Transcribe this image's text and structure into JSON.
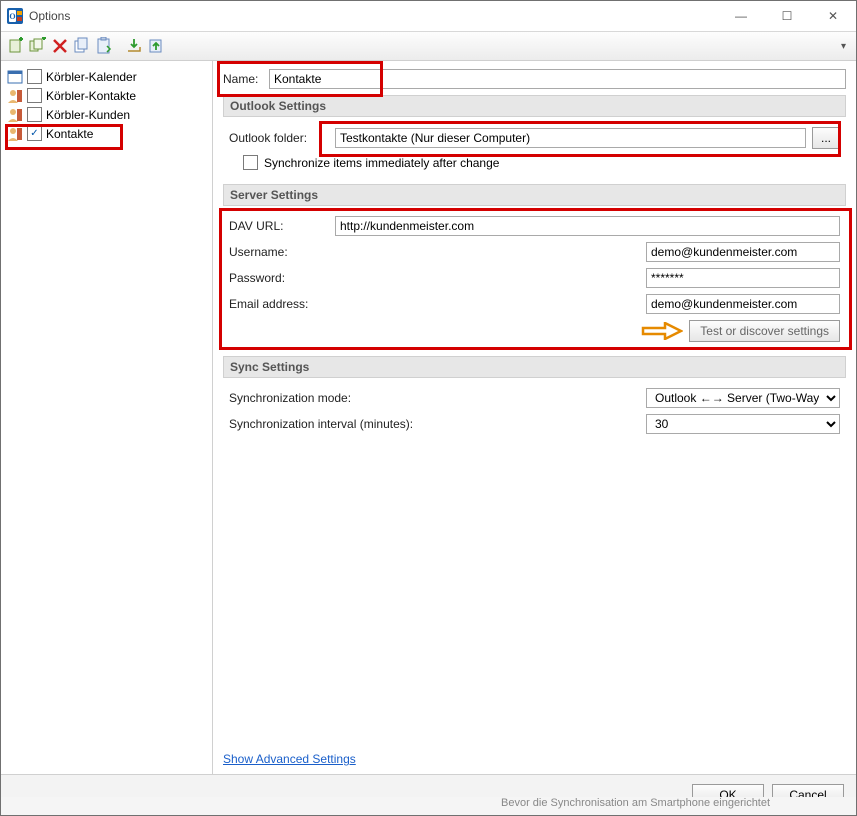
{
  "window": {
    "title": "Options"
  },
  "win": {
    "min": "—",
    "max": "☐",
    "close": "✕"
  },
  "sidebar": {
    "items": [
      {
        "label": "Körbler-Kalender",
        "checked": false,
        "icon": "calendar"
      },
      {
        "label": "Körbler-Kontakte",
        "checked": false,
        "icon": "contacts"
      },
      {
        "label": "Körbler-Kunden",
        "checked": false,
        "icon": "contacts"
      },
      {
        "label": "Kontakte",
        "checked": true,
        "icon": "contacts"
      }
    ]
  },
  "form": {
    "name_label": "Name:",
    "name_value": "Kontakte",
    "section_outlook": "Outlook Settings",
    "outlook_folder_label": "Outlook folder:",
    "outlook_folder_value": "Testkontakte (Nur dieser Computer)",
    "outlook_browse": "...",
    "sync_immediately_label": "Synchronize items immediately after change",
    "section_server": "Server Settings",
    "dav_url_label": "DAV URL:",
    "dav_url_value": "http://kundenmeister.com",
    "username_label": "Username:",
    "username_value": "demo@kundenmeister.com",
    "password_label": "Password:",
    "password_value": "*******",
    "email_label": "Email address:",
    "email_value": "demo@kundenmeister.com",
    "test_button": "Test or discover settings",
    "section_sync": "Sync Settings",
    "sync_mode_label": "Synchronization mode:",
    "sync_mode_value": "Outlook ←→ Server (Two-Way)",
    "sync_interval_label": "Synchronization interval (minutes):",
    "sync_interval_value": "30",
    "advanced_link": "Show Advanced Settings"
  },
  "footer": {
    "ok": "OK",
    "cancel": "Cancel"
  },
  "bottom_hint": "Bevor die Synchronisation am Smartphone eingerichtet"
}
